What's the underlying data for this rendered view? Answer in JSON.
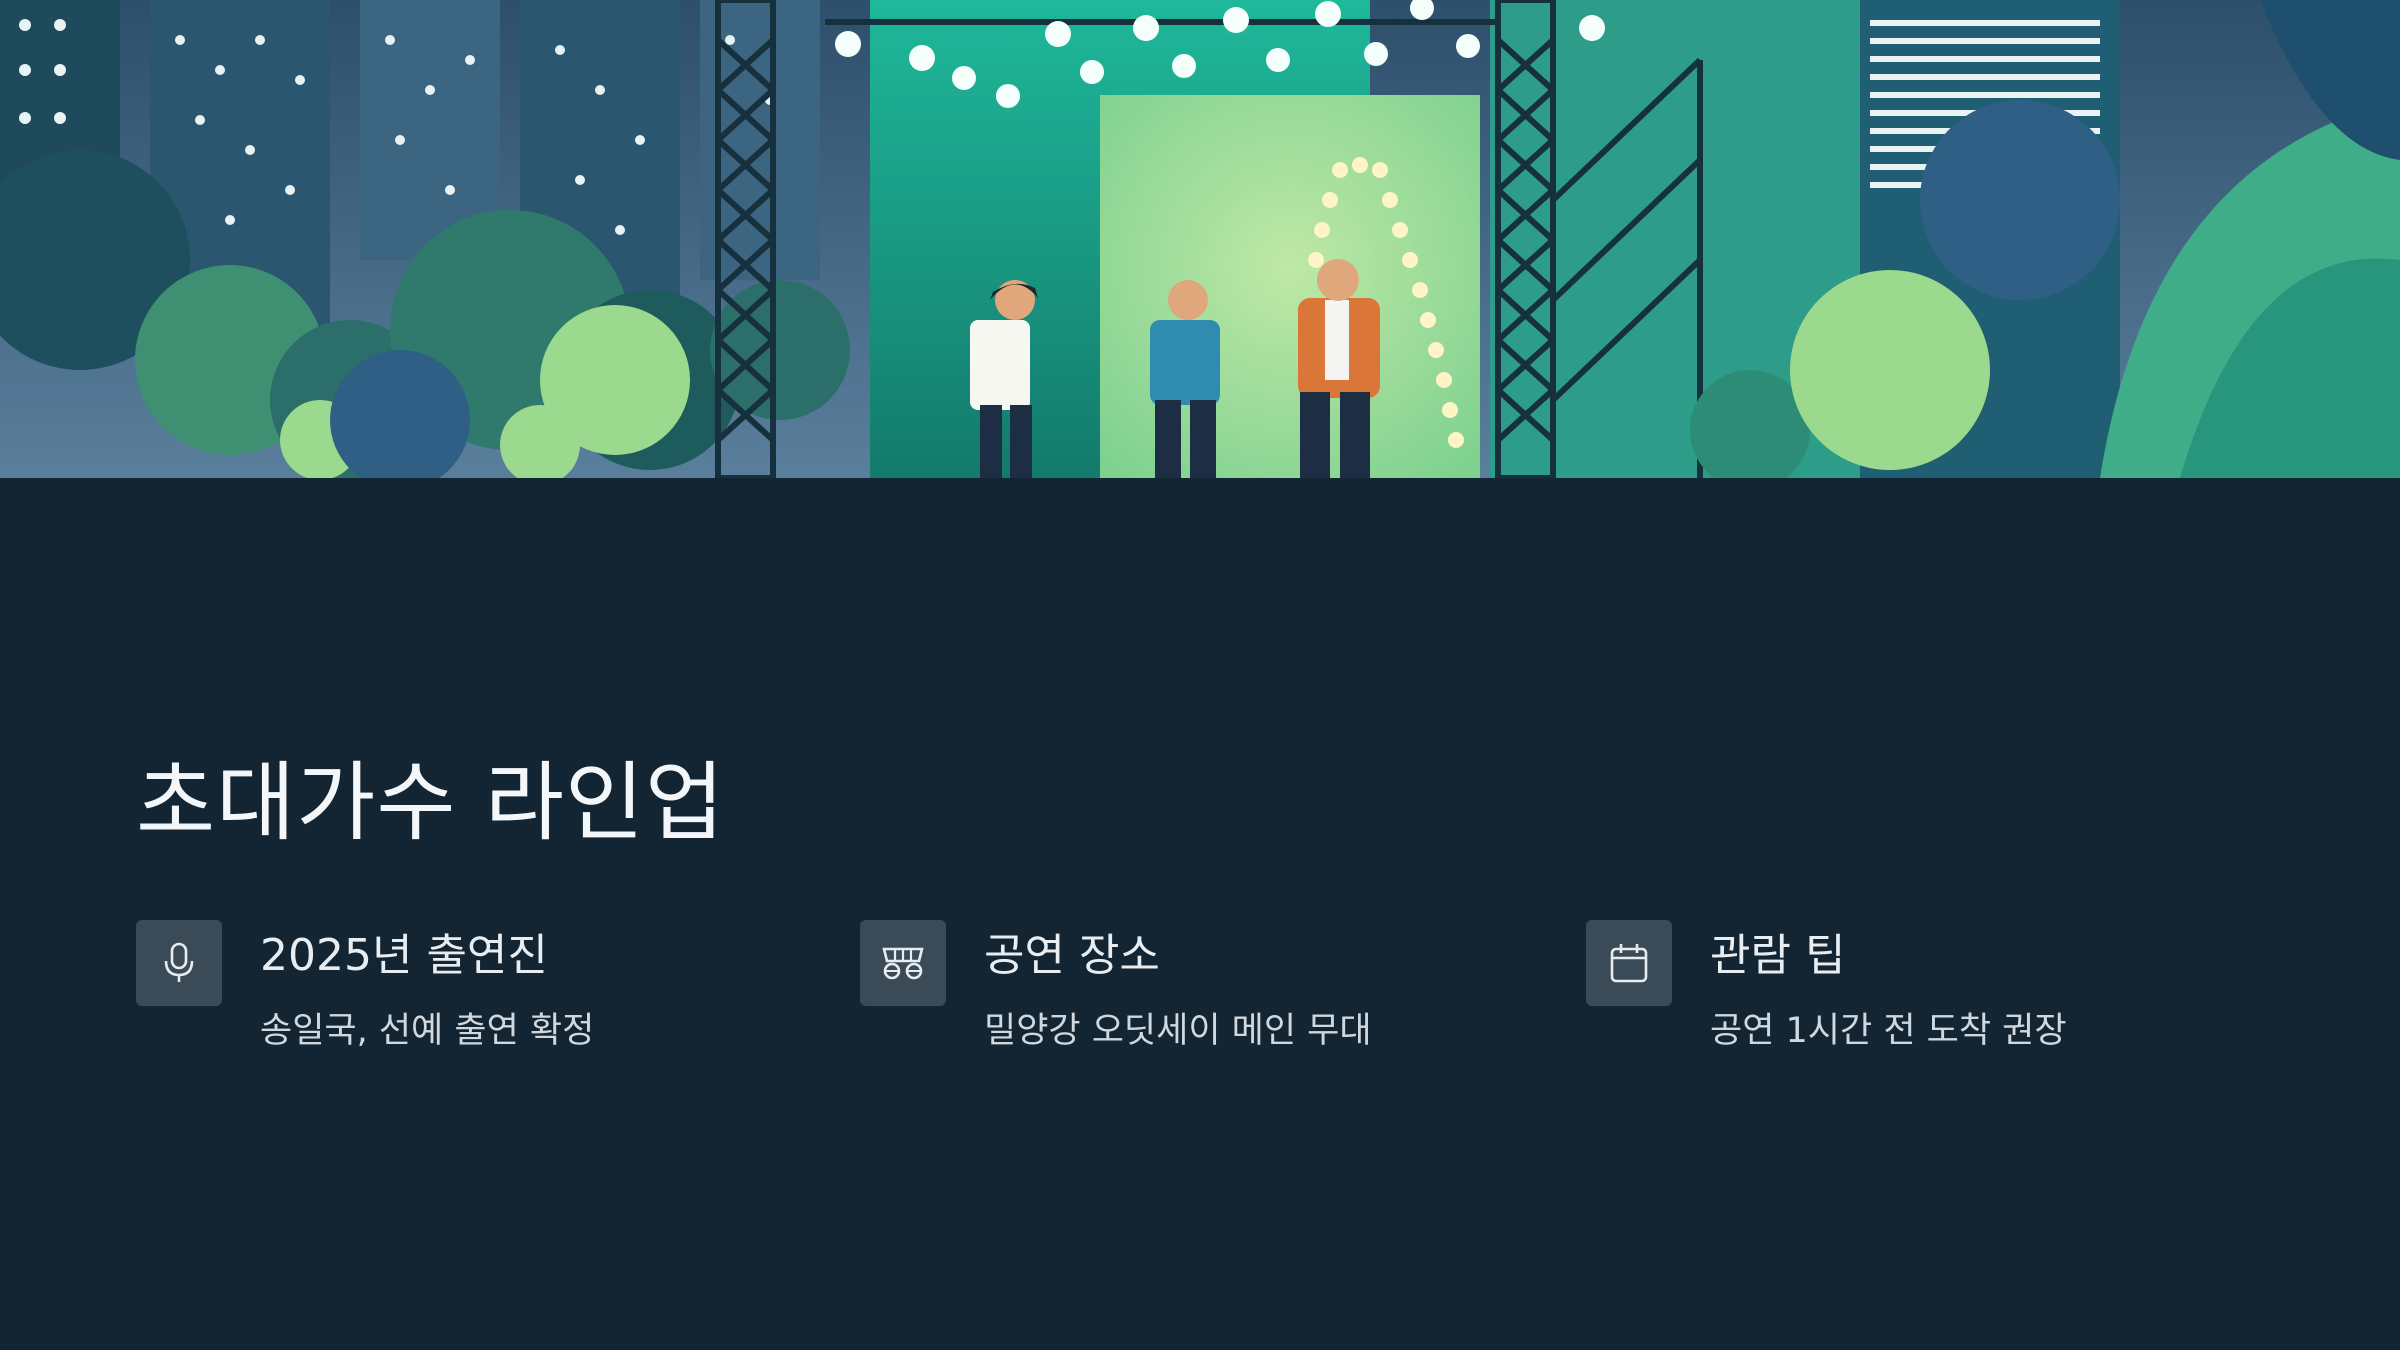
{
  "hero": {
    "image_description": "",
    "alt": ""
  },
  "section": {
    "title": "초대가수 라인업"
  },
  "cards": [
    {
      "icon": "microphone-icon",
      "title": "2025년 출연진",
      "subtitle": "송일국, 선예 출연 확정"
    },
    {
      "icon": "stage-icon",
      "title": "공연 장소",
      "subtitle": "밀양강 오딧세이 메인 무대"
    },
    {
      "icon": "calendar-icon",
      "title": "관람 팁",
      "subtitle": "공연 1시간 전 도착 권장"
    }
  ],
  "colors": {
    "background": "#132533",
    "icon_box": "#3a4b57",
    "accent_green": "#2dbf9a"
  }
}
